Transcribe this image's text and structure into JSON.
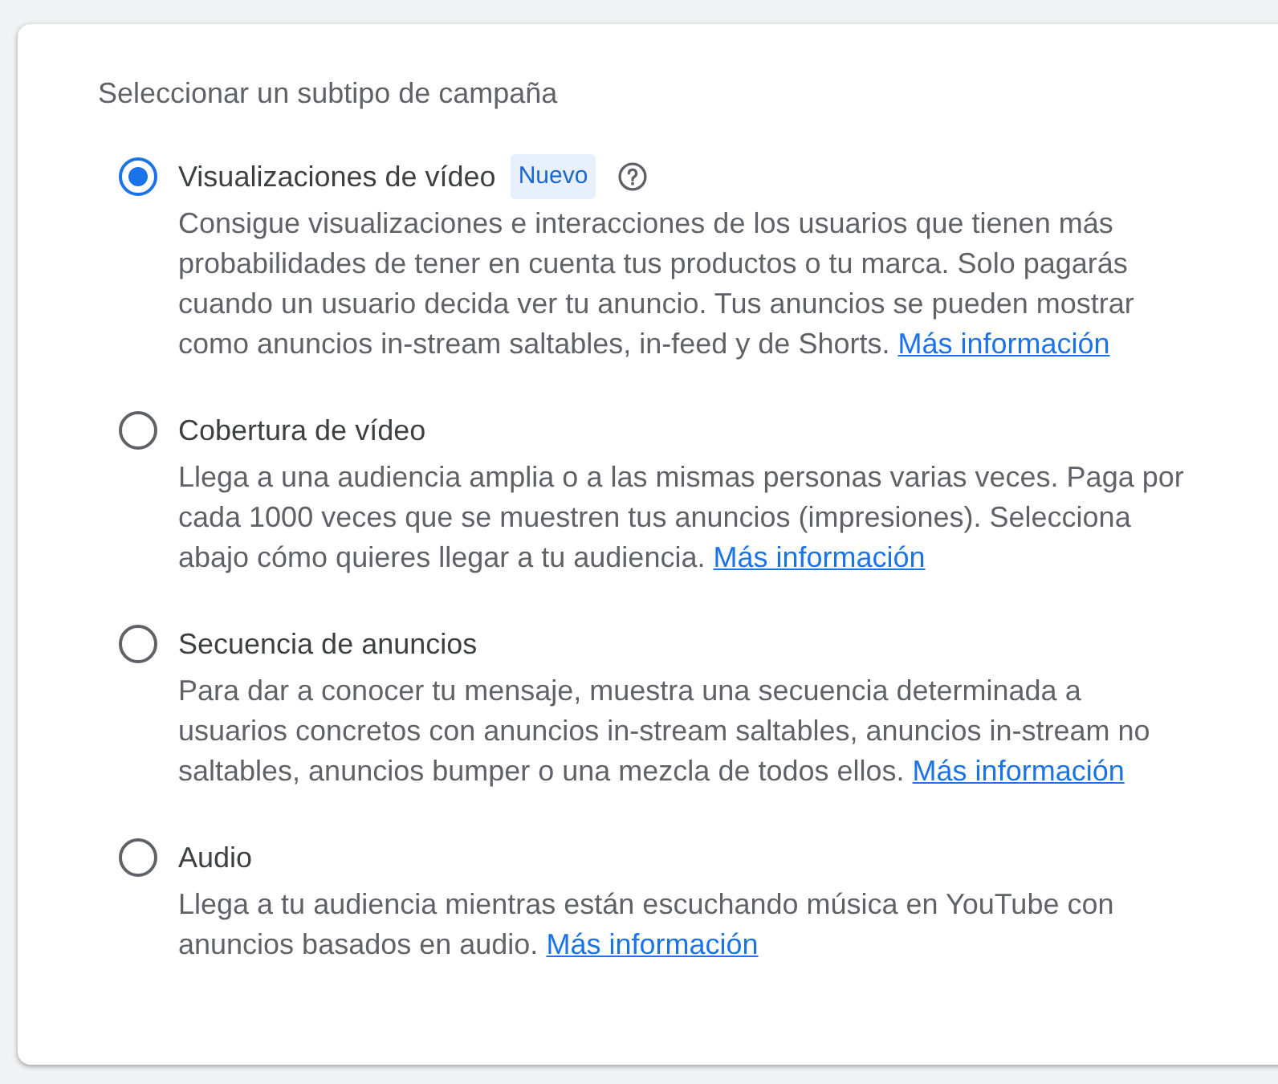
{
  "heading": "Seleccionar un subtipo de campaña",
  "options": [
    {
      "title": "Visualizaciones de vídeo",
      "selected": true,
      "badge": "Nuevo",
      "help": true,
      "description": "Consigue visualizaciones e interacciones de los usuarios que tienen más probabilidades de tener en cuenta tus productos o tu marca. Solo pagarás cuando un usuario decida ver tu anuncio. Tus anuncios se pueden mostrar como anuncios in-stream saltables, in-feed y de Shorts.",
      "link": "Más información"
    },
    {
      "title": "Cobertura de vídeo",
      "selected": false,
      "help": false,
      "description": "Llega a una audiencia amplia o a las mismas personas varias veces. Paga por cada 1000 veces que se muestren tus anuncios (impresiones). Selecciona abajo cómo quieres llegar a tu audiencia.",
      "link": "Más información"
    },
    {
      "title": "Secuencia de anuncios",
      "selected": false,
      "help": false,
      "description": "Para dar a conocer tu mensaje, muestra una secuencia determinada a usuarios concretos con anuncios in-stream saltables, anuncios in-stream no saltables, anuncios bumper o una mezcla de todos ellos.",
      "link": "Más información"
    },
    {
      "title": "Audio",
      "selected": false,
      "help": false,
      "description": "Llega a tu audiencia mientras están escuchando música en YouTube con anuncios basados en audio.",
      "link": "Más información"
    }
  ]
}
